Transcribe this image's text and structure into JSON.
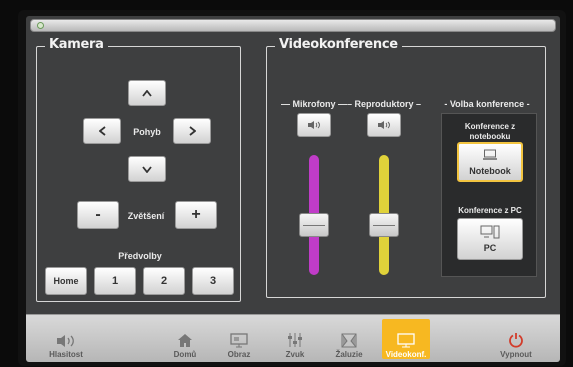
{
  "camera": {
    "title": "Kamera",
    "move_label": "Pohyb",
    "zoom_label": "Zvětšení",
    "zoom_minus": "-",
    "zoom_plus": "+",
    "presets_label": "Předvolby",
    "presets": [
      "Home",
      "1",
      "2",
      "3"
    ]
  },
  "video": {
    "title": "Videokonference",
    "mic_label": "Mikrofony",
    "speaker_label": "Reproduktory",
    "conf_label": "Volba konference",
    "mic_level": 0.42,
    "speaker_level": 0.42,
    "notebook_caption": "Konference z notebooku",
    "notebook_button": "Notebook",
    "pc_caption": "Konference z PC",
    "pc_button": "PC",
    "mic_color": "#c03cc8",
    "speaker_color": "#e0d23a"
  },
  "nav": {
    "items": [
      {
        "label": "Hlasitost",
        "icon": "volume-icon"
      },
      {
        "label": "Domů",
        "icon": "home-icon"
      },
      {
        "label": "Obraz",
        "icon": "monitor-icon"
      },
      {
        "label": "Zvuk",
        "icon": "sliders-icon"
      },
      {
        "label": "Žaluzie",
        "icon": "blinds-icon"
      },
      {
        "label": "Videokonf.",
        "icon": "projector-icon"
      },
      {
        "label": "Vypnout",
        "icon": "power-icon"
      }
    ],
    "active_index": 5,
    "active_color": "#f7b821",
    "power_color": "#d23b2a"
  }
}
